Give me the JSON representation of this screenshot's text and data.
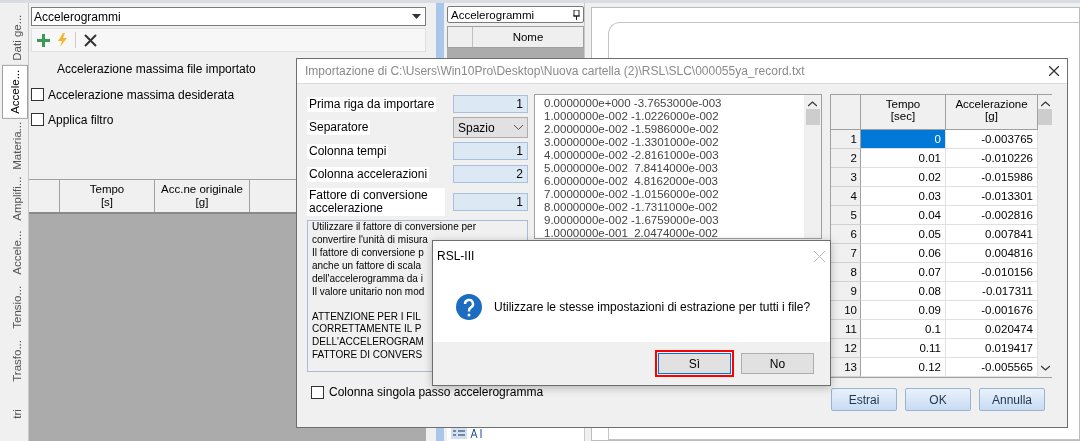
{
  "side_tabs": [
    {
      "label": "Dati ge...",
      "selected": false
    },
    {
      "label": "Accele...",
      "selected": true
    },
    {
      "label": "Materia...",
      "selected": false
    },
    {
      "label": "Amplifi...",
      "selected": false
    },
    {
      "label": "Accele...",
      "selected": false
    },
    {
      "label": "Tensio...",
      "selected": false
    },
    {
      "label": "Trasfo...",
      "selected": false
    },
    {
      "label": "tri",
      "selected": false
    }
  ],
  "left_panel": {
    "dropdown": "Accelerogrammi",
    "max_accel_label": "Accelerazione massima file importato",
    "checkboxes": [
      {
        "label": "Accelerazione massima desiderata",
        "checked": false
      },
      {
        "label": "Applica filtro",
        "checked": false
      }
    ],
    "columns": [
      {
        "title": "Tempo",
        "unit": "[s]"
      },
      {
        "title": "Acc.ne originale",
        "unit": "[g]"
      }
    ]
  },
  "accelerograms_panel": {
    "title": "Accelerogrammi",
    "columns": [
      "Nome"
    ]
  },
  "import_dialog": {
    "title": "Importazione di C:\\Users\\Win10Pro\\Desktop\\Nuova cartella (2)\\RSL\\SLC\\000055ya_record.txt",
    "fields": [
      {
        "kind": "number",
        "label": "Prima riga da importare",
        "value": "1"
      },
      {
        "kind": "select",
        "label": "Separatore",
        "value": "Spazio"
      },
      {
        "kind": "number",
        "label": "Colonna tempi",
        "value": "1"
      },
      {
        "kind": "number",
        "label": "Colonna accelerazioni",
        "value": "2"
      },
      {
        "kind": "number",
        "label": "Fattore di conversione accelerazione",
        "value": "1"
      }
    ],
    "notes": [
      "Utilizzare il fattore di conversione per",
      "convertire l'unità di misura",
      "Il fattore di conversione p",
      "anche un fattore di scala",
      "dell'accelerogramma da i",
      "Il valore unitario non mod",
      "ATTENZIONE PER I FIL",
      "CORRETTAMENTE IL P",
      "DELL'ACCELEROGRAM",
      "FATTORE DI CONVERS"
    ],
    "single_column": {
      "label": "Colonna singola passo accelerogramma",
      "checked": false
    },
    "file_lines": [
      "0.0000000e+000 -3.7653000e-003",
      "1.0000000e-002 -1.0226000e-002",
      "2.0000000e-002 -1.5986000e-002",
      "3.0000000e-002 -1.3301000e-002",
      "4.0000000e-002 -2.8161000e-003",
      "5.0000000e-002  7.8414000e-003",
      "6.0000000e-002  4.8162000e-003",
      "7.0000000e-002 -1.0156000e-002",
      "8.0000000e-002 -1.7311000e-002",
      "9.0000000e-002 -1.6759000e-003",
      "1.0000000e-001  2.0474000e-002"
    ],
    "grid": {
      "columns": [
        {
          "title": "Tempo",
          "unit": "[sec]"
        },
        {
          "title": "Accelerazione",
          "unit": "[g]"
        }
      ],
      "rows": [
        {
          "index": "1",
          "time": "0",
          "accel": "-0.003765",
          "selected": true
        },
        {
          "index": "2",
          "time": "0.01",
          "accel": "-0.010226",
          "selected": false
        },
        {
          "index": "3",
          "time": "0.02",
          "accel": "-0.015986",
          "selected": false
        },
        {
          "index": "4",
          "time": "0.03",
          "accel": "-0.013301",
          "selected": false
        },
        {
          "index": "5",
          "time": "0.04",
          "accel": "-0.002816",
          "selected": false
        },
        {
          "index": "6",
          "time": "0.05",
          "accel": "0.007841",
          "selected": false
        },
        {
          "index": "7",
          "time": "0.06",
          "accel": "0.004816",
          "selected": false
        },
        {
          "index": "8",
          "time": "0.07",
          "accel": "-0.010156",
          "selected": false
        },
        {
          "index": "9",
          "time": "0.08",
          "accel": "-0.017311",
          "selected": false
        },
        {
          "index": "10",
          "time": "0.09",
          "accel": "-0.001676",
          "selected": false
        },
        {
          "index": "11",
          "time": "0.1",
          "accel": "0.020474",
          "selected": false
        },
        {
          "index": "12",
          "time": "0.11",
          "accel": "0.019417",
          "selected": false
        },
        {
          "index": "13",
          "time": "0.12",
          "accel": "-0.005565",
          "selected": false
        }
      ]
    },
    "buttons": [
      "Estrai",
      "OK",
      "Annulla"
    ]
  },
  "message_box": {
    "title": "RSL-III",
    "message": "Utilizzare le stesse impostazioni di estrazione per tutti i file?",
    "buttons": [
      {
        "label": "Sì",
        "highlighted": true
      },
      {
        "label": "No",
        "highlighted": false
      }
    ]
  }
}
